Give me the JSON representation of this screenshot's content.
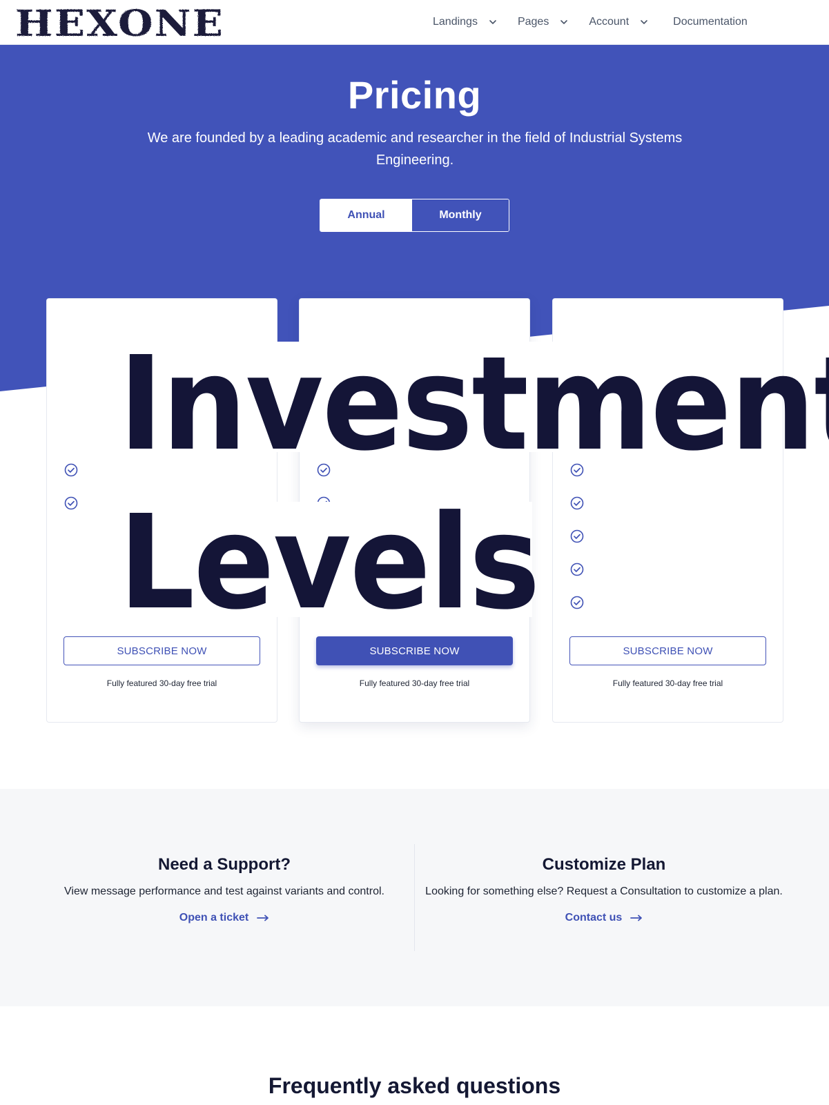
{
  "brand": {
    "logo_text": "HEXONE"
  },
  "nav": {
    "items": [
      {
        "label": "Landings"
      },
      {
        "label": "Pages"
      },
      {
        "label": "Account"
      },
      {
        "label": "Documentation"
      }
    ]
  },
  "hero": {
    "title": "Pricing",
    "subtitle": "We are founded by a leading academic and researcher in the field of Industrial Systems Engineering.",
    "toggle": {
      "annual": "Annual",
      "monthly": "Monthly",
      "selected": "Annual"
    }
  },
  "overlay": {
    "line1": "Investment",
    "line2": "Levels"
  },
  "plans": [
    {
      "button": "SUBSCRIBE NOW",
      "trial": "Fully featured 30-day free trial",
      "checks_visible": 2
    },
    {
      "button": "SUBSCRIBE NOW",
      "trial": "Fully featured 30-day free trial",
      "checks_visible": 2
    },
    {
      "button": "SUBSCRIBE NOW",
      "trial": "Fully featured 30-day free trial",
      "checks_visible": 5
    }
  ],
  "support": {
    "left": {
      "title": "Need a Support?",
      "text": "View message performance and test against variants and control.",
      "link": "Open a ticket"
    },
    "right": {
      "title": "Customize Plan",
      "text": "Looking for something else? Request a Consultation to customize a plan.",
      "link": "Contact us"
    }
  },
  "faq": {
    "title": "Frequently asked questions"
  },
  "colors": {
    "primary": "#4153b9",
    "dark_text": "#141537",
    "section_bg": "#f6f7f9"
  }
}
